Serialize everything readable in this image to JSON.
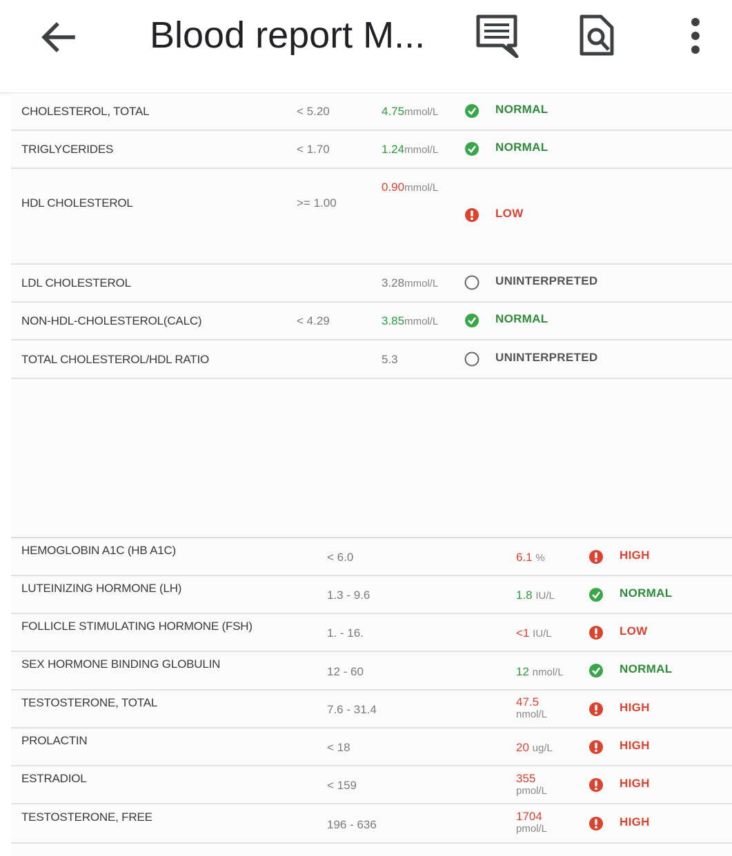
{
  "appbar": {
    "title": "Blood report M...",
    "back_icon": "arrow-back-icon",
    "comment_icon": "comment-icon",
    "find_icon": "find-in-page-icon",
    "more_icon": "more-vert-icon"
  },
  "lipid_rows": [
    {
      "name": "CHOLESTEROL, TOTAL",
      "range": "< 5.20",
      "value": "4.75",
      "unit": "mmol/L",
      "status": "NORMAL"
    },
    {
      "name": "TRIGLYCERIDES",
      "range": "< 1.70",
      "value": "1.24",
      "unit": "mmol/L",
      "status": "NORMAL"
    },
    {
      "name": "HDL CHOLESTEROL",
      "range": ">= 1.00",
      "value": "0.90",
      "unit": "mmol/L",
      "status": "LOW"
    },
    {
      "name": "LDL CHOLESTEROL",
      "range": "",
      "value": "3.28",
      "unit": "mmol/L",
      "status": "UNINTERPRETED"
    },
    {
      "name": "NON-HDL-CHOLESTEROL(CALC)",
      "range": "< 4.29",
      "value": "3.85",
      "unit": "mmol/L",
      "status": "NORMAL"
    },
    {
      "name": "TOTAL CHOLESTEROL/HDL RATIO",
      "range": "",
      "value": "5.3",
      "unit": "",
      "status": "UNINTERPRETED"
    }
  ],
  "hormone_rows": [
    {
      "name": "HEMOGLOBIN A1C (HB A1C)",
      "range": "< 6.0",
      "value": "6.1",
      "unit": "%",
      "status": "HIGH"
    },
    {
      "name": "LUTEINIZING HORMONE (LH)",
      "range": "1.3 - 9.6",
      "value": "1.8",
      "unit": "IU/L",
      "status": "NORMAL"
    },
    {
      "name": "FOLLICLE STIMULATING HORMONE (FSH)",
      "range": "1. - 16.",
      "value": "<1",
      "unit": "IU/L",
      "status": "LOW"
    },
    {
      "name": "SEX HORMONE BINDING GLOBULIN",
      "range": "12 - 60",
      "value": "12",
      "unit": "nmol/L",
      "status": "NORMAL"
    },
    {
      "name": "TESTOSTERONE, TOTAL",
      "range": "7.6 - 31.4",
      "value": "47.5",
      "unit": "nmol/L",
      "status": "HIGH"
    },
    {
      "name": "PROLACTIN",
      "range": "< 18",
      "value": "20",
      "unit": "ug/L",
      "status": "HIGH"
    },
    {
      "name": "ESTRADIOL",
      "range": "< 159",
      "value": "355",
      "unit": "pmol/L",
      "status": "HIGH"
    },
    {
      "name": "TESTOSTERONE, FREE",
      "range": "196 - 636",
      "value": "1704",
      "unit": "pmol/L",
      "status": "HIGH"
    }
  ],
  "colors": {
    "normal": "#2e9a3b",
    "abnormal": "#d9432f",
    "neutral": "#555555"
  }
}
